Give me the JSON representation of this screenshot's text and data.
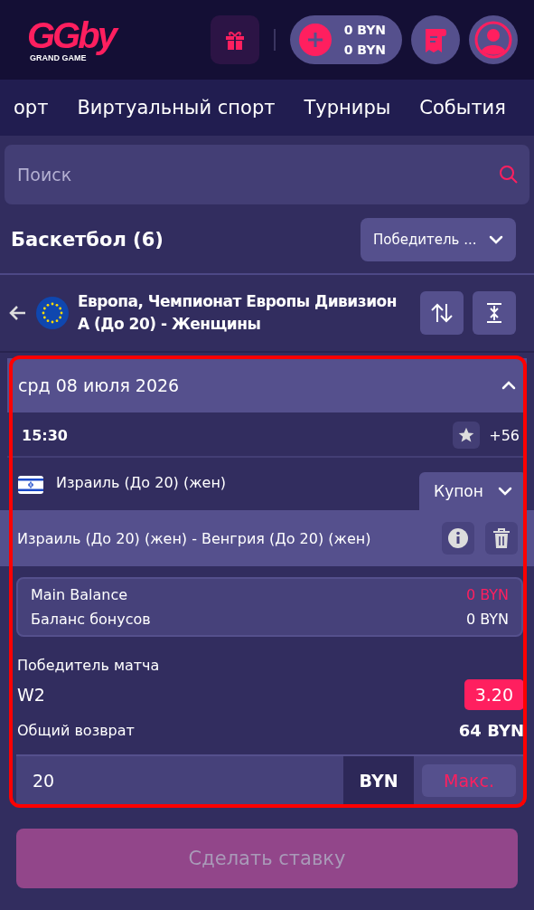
{
  "header": {
    "logo": {
      "mark": "GGby",
      "tagline": "GRAND GAME"
    },
    "balance": {
      "main": "0 BYN",
      "bonus": "0 BYN"
    }
  },
  "nav_tabs": [
    "орт",
    "Виртуальный спорт",
    "Турниры",
    "События"
  ],
  "search": {
    "placeholder": "Поиск"
  },
  "sport": {
    "title": "Баскетбол (6)",
    "market_select": "Победитель ..."
  },
  "league": {
    "title": "Европа, Чемпионат Европы Дивизион А (До 20) - Женщины"
  },
  "day": {
    "label": "срд 08 июля 2026",
    "expanded": true
  },
  "match": {
    "time": "15:30",
    "favorite": false,
    "more": "+56",
    "team": "Израиль (До 20) (жен)"
  },
  "coupon": {
    "highlighted": true,
    "tab": "Купон",
    "expanded": false,
    "event": "Израиль (До 20) (жен) - Венгрия (До 20) (жен)",
    "balances": [
      {
        "label": "Main Balance",
        "value": "0 BYN",
        "kind": "alert"
      },
      {
        "label": "Баланс бонусов",
        "value": "0 BYN",
        "kind": "normal"
      }
    ],
    "market": "Победитель матча",
    "outcome": "W2",
    "odds": "3.20",
    "return_label": "Общий возврат",
    "return_value": "64 BYN",
    "stake": "20",
    "currency": "BYN",
    "max": "Макс."
  },
  "place_bet": {
    "label": "Сделать ставку",
    "disabled": true
  }
}
